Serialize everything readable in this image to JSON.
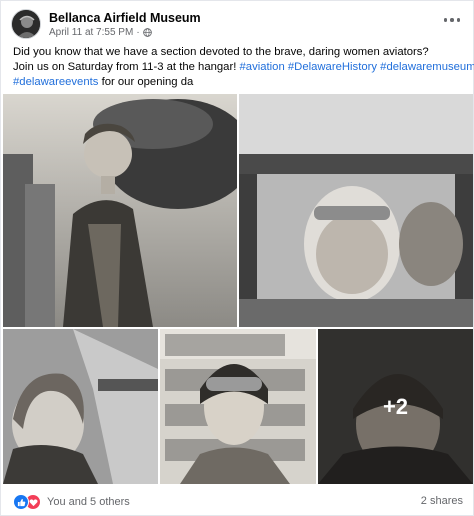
{
  "post": {
    "page_name": "Bellanca Airfield Museum",
    "timestamp": "April 11 at 7:55 PM",
    "separator": "·",
    "privacy_icon": "globe-icon",
    "more_icon": "more-options-icon"
  },
  "text": {
    "line1": "Did you know that we have a section devoted to the brave, daring women aviators?",
    "line2_prefix": "Join us on Saturday from 11-3 at the hangar!",
    "hashtags_line2": [
      "#aviation",
      "#DelawareHistory",
      "#delawaremuseum"
    ],
    "hashtag_line3": "#delawareevents",
    "line3_suffix": "for our opening da"
  },
  "photos": {
    "more_count": "+2"
  },
  "footer": {
    "reactions_text": "You and 5 others",
    "reaction_icons": [
      "like-icon",
      "love-icon"
    ],
    "shares_text": "2 shares"
  },
  "colors": {
    "hashtag": "#216fdb",
    "like": "#1877f2",
    "love": "#f33e58",
    "secondary_text": "#65676b"
  }
}
